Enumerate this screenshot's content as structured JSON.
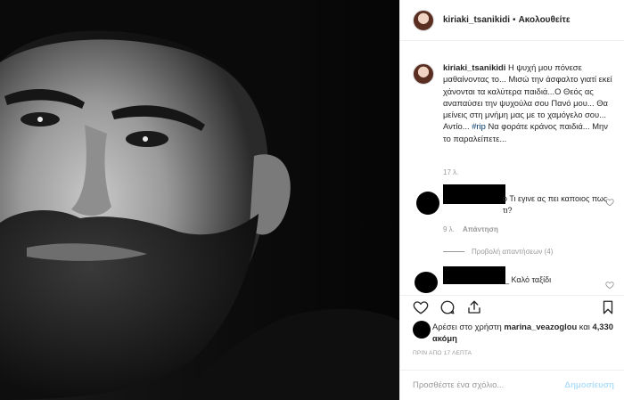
{
  "post": {
    "username": "kiriaki_tsanikidi",
    "separator": "•",
    "follow_label": "Ακολουθείτε"
  },
  "caption": {
    "username": "kiriaki_tsanikidi",
    "text_before_tag": "Η ψυχή μου πόνεσε μαθαίνοντας το... Μισώ την άσφαλτο γιατί εκεί χάνονται τα καλύτερα παιδιά...Ο Θεός ας αναπαύσει την ψυχούλα σου Πανό μου... Θα μείνεις στη μνήμη μας με το χαμόγελο σου... Αντίο... ",
    "hashtag": "#rip",
    "text_after_tag": " Να φοράτε κράνος παιδιά... Μην το παραλείπετε...",
    "time": "17 λ."
  },
  "comment1": {
    "text": "ο Τι εγινε ας πει καποιος πως τι?",
    "time": "9 λ.",
    "reply_label": "Απάντηση",
    "view_replies_label": "Προβολή απαντήσεων (4)"
  },
  "comment2": {
    "text": "_ Καλό ταξίδι"
  },
  "likes": {
    "text_before": "Αρέσει στο χρήστη ",
    "user": "marina_veazoglou",
    "text_mid": " και ",
    "count": "4,330 ακόμη"
  },
  "timestamp": "ΠΡΙΝ ΑΠΟ 17 ΛΕΠΤΑ",
  "add_comment": {
    "placeholder": "Προσθέστε ένα σχόλιο...",
    "post_label": "Δημοσίευση"
  }
}
